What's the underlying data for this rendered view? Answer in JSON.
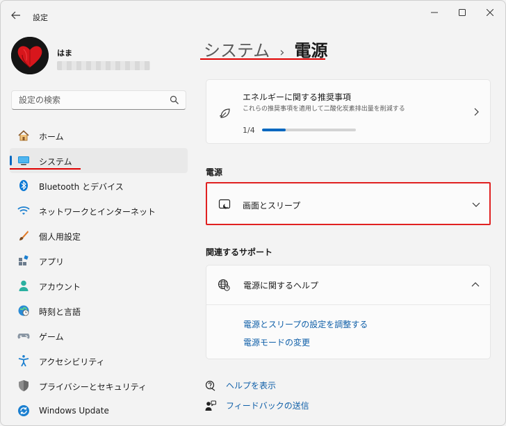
{
  "window": {
    "title": "設定",
    "back_icon": "back-arrow-icon",
    "controls": {
      "minimize": "─",
      "maximize": "☐",
      "close": "✕"
    }
  },
  "profile": {
    "name": "はま"
  },
  "search": {
    "placeholder": "設定の検索",
    "value": ""
  },
  "sidebar": {
    "items": [
      {
        "label": "ホーム",
        "icon": "home-icon",
        "active": false
      },
      {
        "label": "システム",
        "icon": "system-icon",
        "active": true
      },
      {
        "label": "Bluetooth とデバイス",
        "icon": "bluetooth-icon",
        "active": false
      },
      {
        "label": "ネットワークとインターネット",
        "icon": "wifi-icon",
        "active": false
      },
      {
        "label": "個人用設定",
        "icon": "brush-icon",
        "active": false
      },
      {
        "label": "アプリ",
        "icon": "apps-icon",
        "active": false
      },
      {
        "label": "アカウント",
        "icon": "account-icon",
        "active": false
      },
      {
        "label": "時刻と言語",
        "icon": "time-language-icon",
        "active": false
      },
      {
        "label": "ゲーム",
        "icon": "gamepad-icon",
        "active": false
      },
      {
        "label": "アクセシビリティ",
        "icon": "accessibility-icon",
        "active": false
      },
      {
        "label": "プライバシーとセキュリティ",
        "icon": "shield-icon",
        "active": false
      },
      {
        "label": "Windows Update",
        "icon": "windows-update-icon",
        "active": false
      }
    ]
  },
  "breadcrumb": {
    "parent": "システム",
    "separator": "›",
    "current": "電源"
  },
  "recommendation": {
    "title": "エネルギーに関する推奨事項",
    "description": "これらの推奨事項を適用して二酸化炭素排出量を削減する",
    "progress_text": "1/4",
    "progress": 0.25
  },
  "power_section": {
    "heading": "電源",
    "screen_sleep_label": "画面とスリープ"
  },
  "support_section": {
    "heading": "関連するサポート",
    "help_label": "電源に関するヘルプ",
    "links": [
      "電源とスリープの設定を調整する",
      "電源モードの変更"
    ]
  },
  "footer": {
    "get_help": "ヘルプを表示",
    "feedback": "フィードバックの送信"
  },
  "colors": {
    "accent": "#0067c0",
    "annotation_red": "#e00000",
    "link": "#0f5fa8"
  }
}
